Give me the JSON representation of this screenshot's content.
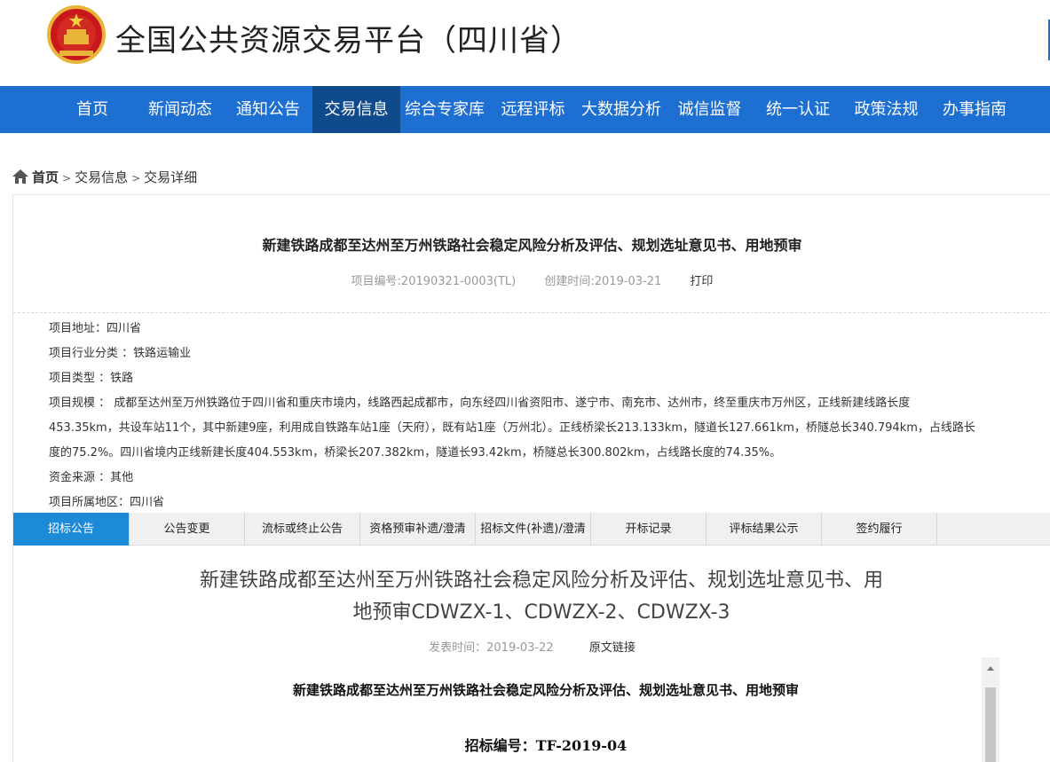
{
  "header": {
    "site_title": "全国公共资源交易平台（四川省）",
    "emblem_icon": "national-emblem-icon"
  },
  "nav": {
    "items": [
      {
        "label": "首页"
      },
      {
        "label": "新闻动态"
      },
      {
        "label": "通知公告"
      },
      {
        "label": "交易信息",
        "active": true
      },
      {
        "label": "综合专家库"
      },
      {
        "label": "远程评标"
      },
      {
        "label": "大数据分析"
      },
      {
        "label": "诚信监督"
      },
      {
        "label": "统一认证"
      },
      {
        "label": "政策法规"
      },
      {
        "label": "办事指南"
      }
    ],
    "colors": {
      "bar": "#1d6fd1",
      "active": "#0f4a8c"
    }
  },
  "breadcrumb": {
    "home": "首页",
    "sep": ">",
    "level1": "交易信息",
    "level2": "交易详细",
    "icon": "home-icon"
  },
  "project": {
    "title": "新建铁路成都至达州至万州铁路社会稳定风险分析及评估、规划选址意见书、用地预审",
    "code": "项目编号:20190321-0003(TL)",
    "created": "创建时间:2019-03-21",
    "print_label": "打印",
    "info": {
      "address": "项目地址：四川省",
      "industry": "项目行业分类 ：铁路运输业",
      "type": "项目类型 ：铁路",
      "scale_lines": [
        "项目规模 ： 成都至达州至万州铁路位于四川省和重庆市境内，线路西起成都市，向东经四川省资阳市、遂宁市、南充市、达州市，终至重庆市万州区，正线新建线路长度",
        "453.35km，共设车站11个，其中新建9座，利用成自铁路车站1座（天府），既有站1座（万州北）。正线桥梁长213.133km，隧道长127.661km，桥隧总长340.794km，占线路长",
        "度的75.2%。四川省境内正线新建长度404.553km，桥梁长207.382km，隧道长93.42km，桥隧总长300.802km，占线路长度的74.35%。"
      ],
      "funding": "资金来源 ：其他",
      "region": "项目所属地区：四川省"
    }
  },
  "tabs": [
    {
      "label": "招标公告",
      "active": true
    },
    {
      "label": "公告变更"
    },
    {
      "label": "流标或终止公告"
    },
    {
      "label": "资格预审补遗/澄清"
    },
    {
      "label": "招标文件(补遗)/澄清"
    },
    {
      "label": "开标记录"
    },
    {
      "label": "评标结果公示"
    },
    {
      "label": "签约履行"
    }
  ],
  "announcement": {
    "title_line1": "新建铁路成都至达州至万州铁路社会稳定风险分析及评估、规划选址意见书、用",
    "title_line2": "地预审CDWZX-1、CDWZX-2、CDWZX-3",
    "publish_time": "发表时间：2019-03-22",
    "source_link": "原文链接",
    "doc_heading": "新建铁路成都至达州至万州铁路社会稳定风险分析及评估、规划选址意见书、用地预审",
    "doc_number": "招标编号：TF-2019-04"
  }
}
